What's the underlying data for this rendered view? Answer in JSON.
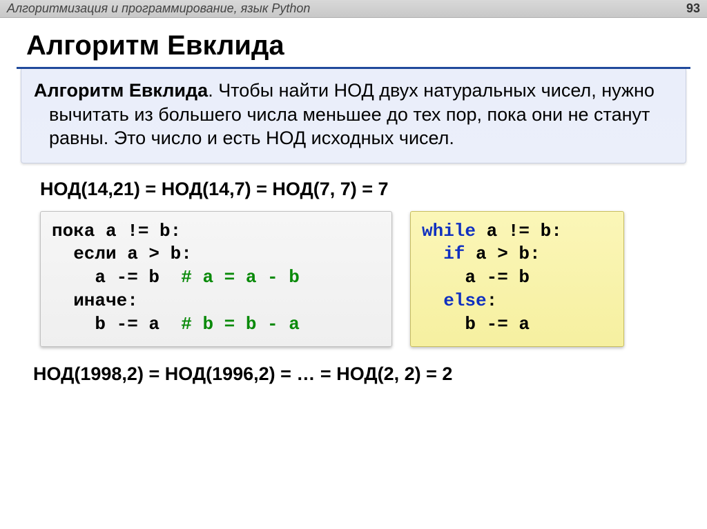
{
  "header": {
    "title": "Алгоритмизация и программирование, язык Python",
    "page_number": "93"
  },
  "main_title": "Алгоритм Евклида",
  "definition": {
    "title": "Алгоритм Евклида",
    "text": ". Чтобы найти НОД двух натуральных чисел, нужно вычитать из большего числа меньшее до тех пор, пока они не станут равны. Это число и есть НОД исходных чисел."
  },
  "example1": "НОД(14,21) = НОД(14,7) = НОД(7, 7) = 7",
  "pseudocode": {
    "l1": "пока a != b:",
    "l2": "  если a > b:",
    "l3a": "    a -= b  ",
    "l3b": "# a = a - b",
    "l4": "  иначе:",
    "l5a": "    b -= a  ",
    "l5b": "# b = b - a"
  },
  "python": {
    "l1a": "while",
    "l1b": " a != b:",
    "l2a": "  if",
    "l2b": " a > b:",
    "l3": "    a -= b",
    "l4a": "  else",
    "l4b": ":",
    "l5": "    b -= a"
  },
  "example2": "НОД(1998,2) = НОД(1996,2) = … = НОД(2, 2) = 2"
}
